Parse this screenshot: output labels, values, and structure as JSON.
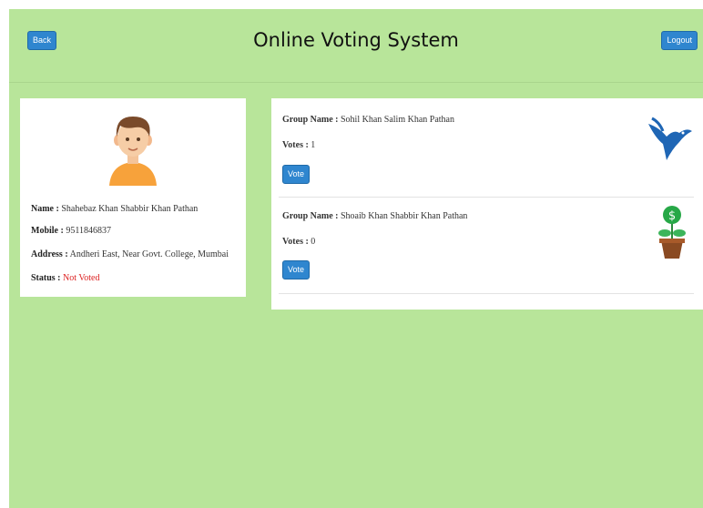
{
  "header": {
    "back_label": "Back",
    "title": "Online Voting System",
    "logout_label": "Logout"
  },
  "profile": {
    "name_label": "Name :",
    "name_value": "Shahebaz Khan Shabbir Khan Pathan",
    "mobile_label": "Mobile :",
    "mobile_value": "9511846837",
    "address_label": "Address :",
    "address_value": "Andheri East, Near Govt. College, Mumbai",
    "status_label": "Status :",
    "status_value": "Not Voted",
    "status_color": "#d22222"
  },
  "groups": [
    {
      "group_name_label": "Group Name :",
      "group_name_value": "Sohil Khan Salim Khan Pathan",
      "votes_label": "Votes :",
      "votes_value": "1",
      "vote_label": "Vote",
      "icon": "bird-icon"
    },
    {
      "group_name_label": "Group Name :",
      "group_name_value": "Shoaib Khan Shabbir Khan Pathan",
      "votes_label": "Votes :",
      "votes_value": "0",
      "vote_label": "Vote",
      "icon": "money-plant-icon"
    }
  ],
  "colors": {
    "background": "#b8e59a",
    "button": "#2f86cf",
    "card": "#ffffff"
  }
}
